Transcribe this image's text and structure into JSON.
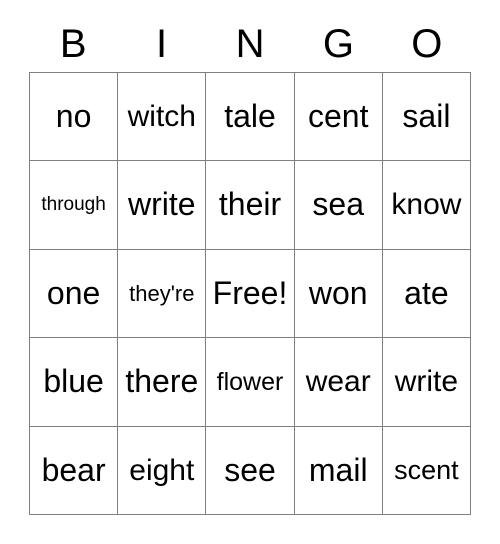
{
  "card": {
    "title_letters": [
      "B",
      "I",
      "N",
      "G",
      "O"
    ],
    "colors": {
      "background": "#ffffff",
      "text": "#000000",
      "grid_line": "#808080"
    },
    "rows": [
      [
        {
          "text": "no",
          "size": "fs-xl"
        },
        {
          "text": "witch",
          "size": "fs-lg"
        },
        {
          "text": "tale",
          "size": "fs-xl"
        },
        {
          "text": "cent",
          "size": "fs-xl"
        },
        {
          "text": "sail",
          "size": "fs-xl"
        }
      ],
      [
        {
          "text": "through",
          "size": "fs-xs"
        },
        {
          "text": "write",
          "size": "fs-xl"
        },
        {
          "text": "their",
          "size": "fs-xl"
        },
        {
          "text": "sea",
          "size": "fs-xl"
        },
        {
          "text": "know",
          "size": "fs-lg"
        }
      ],
      [
        {
          "text": "one",
          "size": "fs-xl"
        },
        {
          "text": "they're",
          "size": "fs-sm"
        },
        {
          "text": "Free!",
          "size": "fs-xl"
        },
        {
          "text": "won",
          "size": "fs-xl"
        },
        {
          "text": "ate",
          "size": "fs-xl"
        }
      ],
      [
        {
          "text": "blue",
          "size": "fs-xl"
        },
        {
          "text": "there",
          "size": "fs-xl"
        },
        {
          "text": "flower",
          "size": "fs-md"
        },
        {
          "text": "wear",
          "size": "fs-lg"
        },
        {
          "text": "write",
          "size": "fs-lg"
        }
      ],
      [
        {
          "text": "bear",
          "size": "fs-xl"
        },
        {
          "text": "eight",
          "size": "fs-lg"
        },
        {
          "text": "see",
          "size": "fs-xl"
        },
        {
          "text": "mail",
          "size": "fs-xl"
        },
        {
          "text": "scent",
          "size": "fs-mdl"
        }
      ]
    ]
  }
}
